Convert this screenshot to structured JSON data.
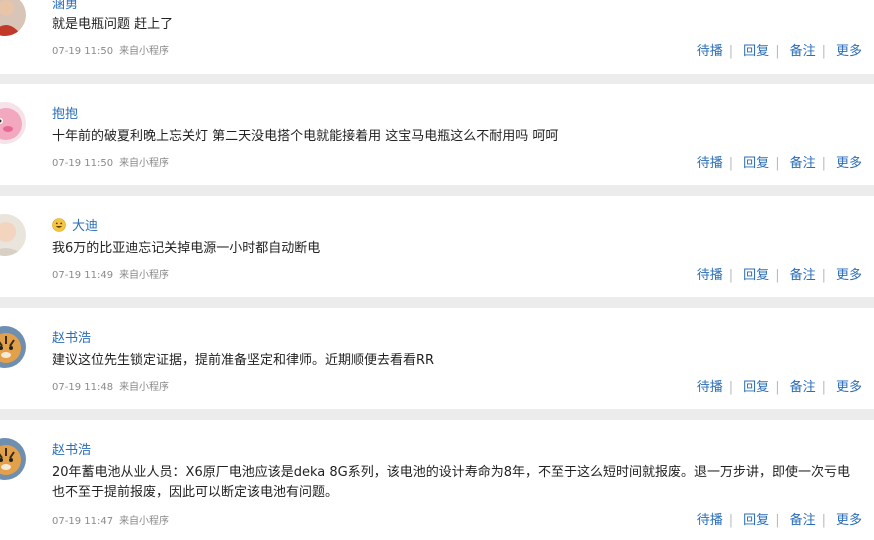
{
  "comments": [
    {
      "username": "涵勇",
      "text": "就是电瓶问题 赶上了",
      "time": "07-19 11:50",
      "source": "来自小程序",
      "avatar": "portrait-red-avatar"
    },
    {
      "username": "抱抱",
      "text": "十年前的破夏利晚上忘关灯 第二天没电搭个电就能接着用 这宝马电瓶这么不耐用吗 呵呵",
      "time": "07-19 11:50",
      "source": "来自小程序",
      "avatar": "pink-plush-avatar"
    },
    {
      "username": "大迪",
      "text": "我6万的比亚迪忘记关掉电源一小时都自动断电",
      "time": "07-19 11:49",
      "source": "来自小程序",
      "avatar": "baby-avatar",
      "emoji": "grinning-face"
    },
    {
      "username": "赵书浩",
      "text": "建议这位先生锁定证据，提前准备坚定和律师。近期顺便去看看RR",
      "time": "07-19 11:48",
      "source": "来自小程序",
      "avatar": "tiger-avatar"
    },
    {
      "username": "赵书浩",
      "text": "20年蓄电池从业人员：X6原厂电池应该是deka 8G系列，该电池的设计寿命为8年，不至于这么短时间就报废。退一万步讲，即使一次亏电也不至于提前报废，因此可以断定该电池有问题。",
      "time": "07-19 11:47",
      "source": "来自小程序",
      "avatar": "tiger-avatar"
    }
  ],
  "actions": {
    "pending": "待播",
    "reply": "回复",
    "note": "备注",
    "more": "更多"
  }
}
